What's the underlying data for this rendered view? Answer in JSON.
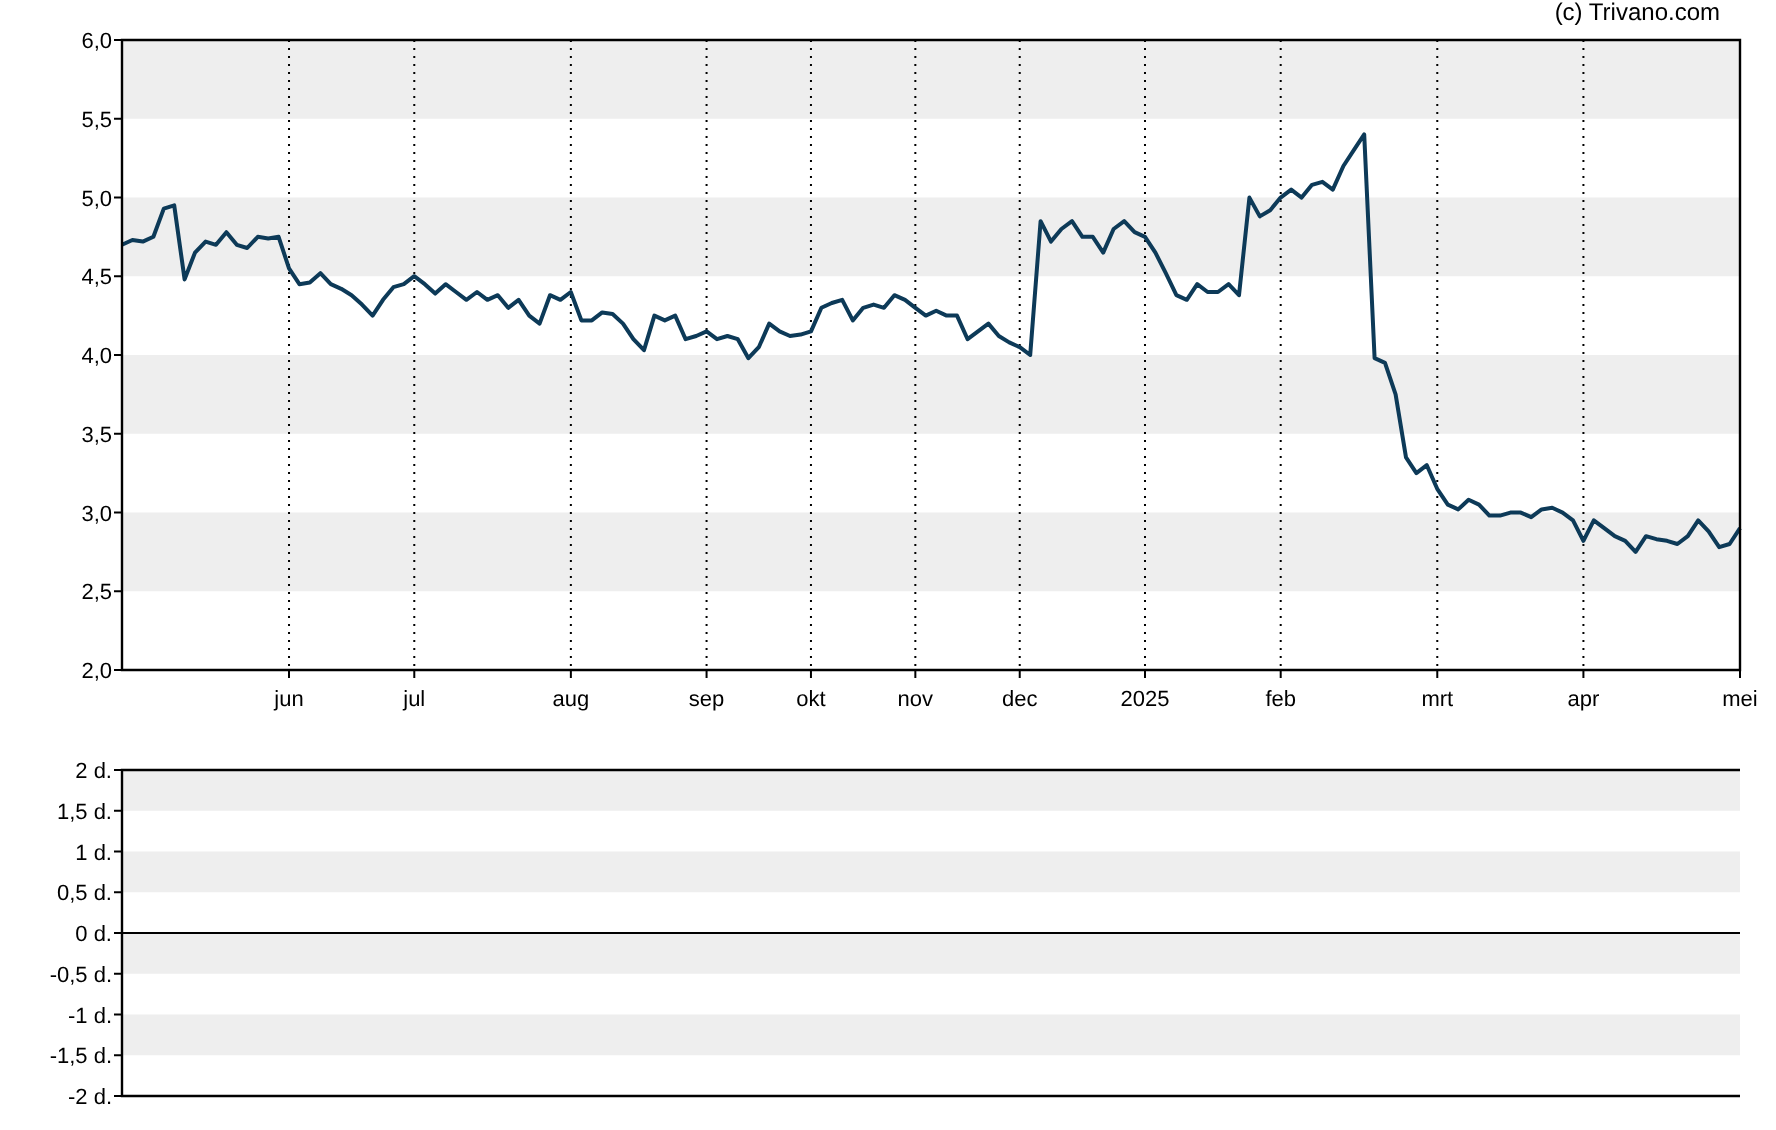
{
  "credit": "(c) Trivano.com",
  "price_chart": {
    "chart_data": {
      "type": "line",
      "ylim": [
        2,
        6
      ],
      "categories": [
        null,
        null,
        null,
        null,
        null,
        null,
        null,
        null,
        null,
        null,
        null,
        null,
        null,
        null,
        null,
        null,
        "jun",
        null,
        null,
        null,
        null,
        null,
        null,
        null,
        null,
        null,
        null,
        null,
        "jul",
        null,
        null,
        null,
        null,
        null,
        null,
        null,
        null,
        null,
        null,
        null,
        null,
        null,
        null,
        "aug",
        null,
        null,
        null,
        null,
        null,
        null,
        null,
        null,
        null,
        null,
        null,
        null,
        "sep",
        null,
        null,
        null,
        null,
        null,
        null,
        null,
        null,
        null,
        "okt",
        null,
        null,
        null,
        null,
        null,
        null,
        null,
        null,
        null,
        "nov",
        null,
        null,
        null,
        null,
        null,
        null,
        null,
        null,
        null,
        "dec",
        null,
        null,
        null,
        null,
        null,
        null,
        null,
        null,
        null,
        null,
        null,
        "2025",
        null,
        null,
        null,
        null,
        null,
        null,
        null,
        null,
        null,
        null,
        null,
        null,
        "feb",
        null,
        null,
        null,
        null,
        null,
        null,
        null,
        null,
        null,
        null,
        null,
        null,
        null,
        null,
        "mrt",
        null,
        null,
        null,
        null,
        null,
        null,
        null,
        null,
        null,
        null,
        null,
        null,
        null,
        "apr",
        null,
        null,
        null,
        null,
        null,
        null,
        null,
        null,
        null,
        null,
        null,
        null,
        null,
        null,
        "mei"
      ],
      "yticks": [
        {
          "value": 2,
          "label": "2,0"
        },
        {
          "value": 2.5,
          "label": "2,5"
        },
        {
          "value": 3,
          "label": "3,0"
        },
        {
          "value": 3.5,
          "label": "3,5"
        },
        {
          "value": 4,
          "label": "4,0"
        },
        {
          "value": 4.5,
          "label": "4,5"
        },
        {
          "value": 5,
          "label": "5,0"
        },
        {
          "value": 5.5,
          "label": "5,5"
        },
        {
          "value": 6,
          "label": "6,0"
        }
      ],
      "series": [
        {
          "color": "#0d3a58",
          "values": [
            4.7,
            4.73,
            4.72,
            4.75,
            4.93,
            4.95,
            4.48,
            4.65,
            4.72,
            4.7,
            4.78,
            4.7,
            4.68,
            4.75,
            4.74,
            4.75,
            4.55,
            4.45,
            4.46,
            4.52,
            4.45,
            4.42,
            4.38,
            4.32,
            4.25,
            4.35,
            4.43,
            4.45,
            4.5,
            4.45,
            4.39,
            4.45,
            4.4,
            4.35,
            4.4,
            4.35,
            4.38,
            4.3,
            4.35,
            4.25,
            4.2,
            4.38,
            4.35,
            4.4,
            4.22,
            4.22,
            4.27,
            4.26,
            4.2,
            4.1,
            4.03,
            4.25,
            4.22,
            4.25,
            4.1,
            4.12,
            4.15,
            4.1,
            4.12,
            4.1,
            3.98,
            4.05,
            4.2,
            4.15,
            4.12,
            4.13,
            4.15,
            4.3,
            4.33,
            4.35,
            4.22,
            4.3,
            4.32,
            4.3,
            4.38,
            4.35,
            4.3,
            4.25,
            4.28,
            4.25,
            4.25,
            4.1,
            4.15,
            4.2,
            4.12,
            4.08,
            4.05,
            4.0,
            4.85,
            4.72,
            4.8,
            4.85,
            4.75,
            4.75,
            4.65,
            4.8,
            4.85,
            4.78,
            4.75,
            4.65,
            4.52,
            4.38,
            4.35,
            4.45,
            4.4,
            4.4,
            4.45,
            4.38,
            5.0,
            4.88,
            4.92,
            5.0,
            5.05,
            5.0,
            5.08,
            5.1,
            5.05,
            5.2,
            5.3,
            5.4,
            3.98,
            3.95,
            3.75,
            3.35,
            3.25,
            3.3,
            3.15,
            3.05,
            3.02,
            3.08,
            3.05,
            2.98,
            2.98,
            3.0,
            3.0,
            2.97,
            3.02,
            3.03,
            3.0,
            2.95,
            2.82,
            2.95,
            2.9,
            2.85,
            2.82,
            2.75,
            2.85,
            2.83,
            2.82,
            2.8,
            2.85,
            2.95,
            2.88,
            2.78,
            2.8,
            2.9
          ]
        }
      ]
    }
  },
  "lower_chart": {
    "chart_data": {
      "type": "line",
      "ylim": [
        -2,
        2
      ],
      "categories": [
        null,
        null,
        null,
        null,
        null,
        null,
        null,
        null,
        null,
        null,
        null,
        null
      ],
      "yticks": [
        {
          "value": -2,
          "label": "-2 d."
        },
        {
          "value": -1.5,
          "label": "-1,5 d."
        },
        {
          "value": -1,
          "label": "-1 d."
        },
        {
          "value": -0.5,
          "label": "-0,5 d."
        },
        {
          "value": 0,
          "label": "0 d."
        },
        {
          "value": 0.5,
          "label": "0,5 d."
        },
        {
          "value": 1,
          "label": "1 d."
        },
        {
          "value": 1.5,
          "label": "1,5 d."
        },
        {
          "value": 2,
          "label": "2 d."
        }
      ]
    }
  }
}
